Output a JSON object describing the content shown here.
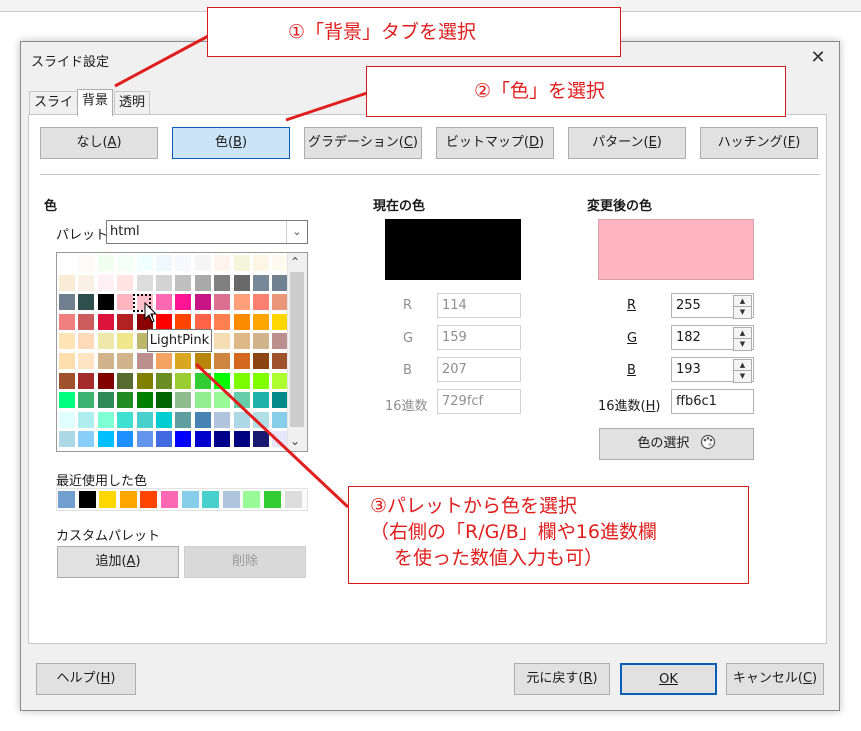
{
  "dialog": {
    "title": "スライド設定",
    "close_label": "✕"
  },
  "tabs": [
    {
      "label": "スライド"
    },
    {
      "label": "背景"
    },
    {
      "label": "透明"
    }
  ],
  "fill_buttons": [
    {
      "label": "なし(",
      "key": "A"
    },
    {
      "label": "色(",
      "key": "B"
    },
    {
      "label": "グラデーション(",
      "key": "C"
    },
    {
      "label": "ビットマップ(",
      "key": "D"
    },
    {
      "label": "パターン(",
      "key": "E"
    },
    {
      "label": "ハッチング(",
      "key": "F"
    }
  ],
  "color_section": {
    "heading": "色",
    "palette_label": "パレット:",
    "palette_value": "html",
    "tooltip": "LightPink",
    "recent_label": "最近使用した色",
    "custom_label": "カスタムパレット",
    "add_button": "追加(",
    "add_key": "A",
    "delete_button": "削除"
  },
  "current_color": {
    "heading": "現在の色",
    "swatch": "#000000",
    "r_label": "R",
    "r_value": "114",
    "g_label": "G",
    "g_value": "159",
    "b_label": "B",
    "b_value": "207",
    "hex_label": "16進数",
    "hex_value": "729fcf"
  },
  "new_color": {
    "heading": "変更後の色",
    "swatch": "#ffb6c1",
    "r_label": "R",
    "r_value": "255",
    "g_label": "G",
    "g_value": "182",
    "b_label": "B",
    "b_value": "193",
    "hex_label": "16進数(",
    "hex_key": "H",
    "hex_value": "ffb6c1",
    "pick_button": "色の選択"
  },
  "footer": {
    "help": "ヘルプ(",
    "help_key": "H",
    "reset": "元に戻す(",
    "reset_key": "R",
    "ok": "OK",
    "cancel": "キャンセル(",
    "cancel_key": "C"
  },
  "annotations": {
    "callout1": "①「背景」タブを選択",
    "callout2": "②「色」を選択",
    "callout3_line1": "③パレットから色を選択",
    "callout3_line2": "（右側の「R/G/B」欄や16進数欄",
    "callout3_line3": "を使った数値入力も可）"
  },
  "palette_colors": [
    "#ffffff",
    "#fffafa",
    "#f0fff0",
    "#f5fffa",
    "#f0ffff",
    "#f0f8ff",
    "#f8f8ff",
    "#f5f5f5",
    "#fff5ee",
    "#f5f5dc",
    "#fdf5e6",
    "#fffaf0",
    "#fffff0",
    "#faebd7",
    "#faf0e6",
    "#fff0f5",
    "#ffe4e1",
    "#dcdcdc",
    "#d3d3d3",
    "#c0c0c0",
    "#a9a9a9",
    "#808080",
    "#696969",
    "#778899",
    "#708090",
    "#d0d0d0",
    "#708090",
    "#2f4f4f",
    "#000000",
    "#ffb6c1",
    "#ffc0cb",
    "#ff69b4",
    "#ff1493",
    "#c71585",
    "#db7093",
    "#ffa07a",
    "#fa8072",
    "#e9967a",
    "#f08080",
    "#f08080",
    "#cd5c5c",
    "#dc143c",
    "#b22222",
    "#8b0000",
    "#ff0000",
    "#ff4500",
    "#ff6347",
    "#ff7f50",
    "#ff8c00",
    "#ffa500",
    "#ffd700",
    "#ffff00",
    "#ffe4b5",
    "#ffdab9",
    "#eee8aa",
    "#f0e68c",
    "#bdb76b",
    "#ffefd5",
    "#ffebcd",
    "#ffe4c4",
    "#f5deb3",
    "#deb887",
    "#d2b48c",
    "#bc8f8f",
    "#f4a460",
    "#ffdead",
    "#ffe4c4",
    "#d2b48c",
    "#d2b48c",
    "#bc8f8f",
    "#f4a460",
    "#daa520",
    "#b8860b",
    "#cd853f",
    "#d2691e",
    "#8b4513",
    "#a0522d",
    "#a52a2a",
    "#a0522d",
    "#a52a2a",
    "#800000",
    "#556b2f",
    "#808000",
    "#6b8e23",
    "#9acd32",
    "#32cd32",
    "#00ff00",
    "#7cfc00",
    "#7fff00",
    "#adff2f",
    "#00fa9a",
    "#00ff7f",
    "#3cb371",
    "#2e8b57",
    "#228b22",
    "#008000",
    "#006400",
    "#8fbc8f",
    "#90ee90",
    "#98fb98",
    "#66cdaa",
    "#20b2aa",
    "#008b8b",
    "#008080",
    "#e0ffff",
    "#afeeee",
    "#7fffd4",
    "#40e0d0",
    "#48d1cc",
    "#00ced1",
    "#5f9ea0",
    "#4682b4",
    "#b0c4de",
    "#add8e6",
    "#b0e0e6",
    "#87ceeb",
    "#87cefa",
    "#add8e6",
    "#87cefa",
    "#00bfff",
    "#1e90ff",
    "#6495ed",
    "#4169e1",
    "#0000ff",
    "#0000cd",
    "#00008b",
    "#000080",
    "#191970",
    "#e6e6fa",
    "#d8bfd8"
  ],
  "recent_colors": [
    "#729fcf",
    "#000000",
    "#ffd700",
    "#ffa500",
    "#ff4500",
    "#ff69b4",
    "#87ceeb",
    "#48d1cc",
    "#b0c4de",
    "#98fb98",
    "#32cd32",
    "#dcdcdc"
  ]
}
